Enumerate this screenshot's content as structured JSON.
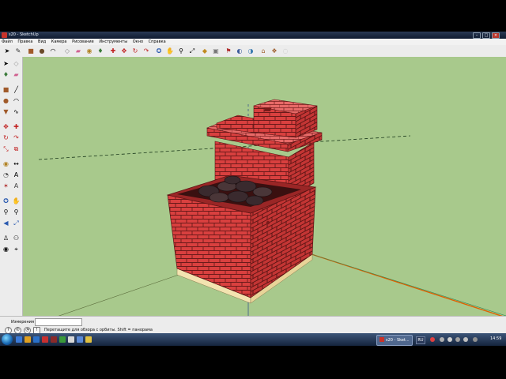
{
  "window": {
    "title": "s20 - SketchUp",
    "controls": [
      "–",
      "□",
      "×"
    ]
  },
  "menu": [
    "Файл",
    "Правка",
    "Вид",
    "Камера",
    "Рисование",
    "Инструменты",
    "Окно",
    "Справка"
  ],
  "toolbar_icons": [
    "select-arrow-icon",
    "pencil-icon",
    "box-icon",
    "circle-icon",
    "arc-icon",
    "shape-icon",
    "eraser-icon",
    "tape-measure-icon",
    "paint-bucket-icon",
    "push-pull-icon",
    "move-icon",
    "rotate-icon",
    "follow-me-icon",
    "orbit-icon",
    "pan-icon",
    "zoom-icon",
    "zoom-extents-icon",
    "components-icon",
    "section-icon",
    "axes-icon",
    "walk-icon",
    "look-around-icon",
    "warehouse-icon",
    "share-icon"
  ],
  "left_tool_icons": [
    "select-icon",
    "make-component-icon",
    "paint-bucket-icon",
    "eraser-icon",
    "rectangle-icon",
    "line-icon",
    "circle-icon",
    "arc-icon",
    "polygon-icon",
    "freehand-icon",
    "move-icon",
    "push-pull-icon",
    "rotate-icon",
    "follow-me-icon",
    "scale-icon",
    "offset-icon",
    "tape-measure-icon",
    "dimension-icon",
    "protractor-icon",
    "text-icon",
    "axes-icon",
    "3d-text-icon",
    "orbit-icon",
    "pan-icon",
    "zoom-icon",
    "zoom-window-icon",
    "previous-view-icon",
    "zoom-extents-icon",
    "position-camera-icon",
    "walk-icon",
    "look-around-icon",
    "section-plane-icon"
  ],
  "status": {
    "measure_label": "Измерения",
    "measure_value": "",
    "hint": "Перетащите для обзора с орбиты. Shift = панорама"
  },
  "taskbar": {
    "task_label": "s20 - Sket...",
    "language": "RU",
    "clock": "14:59"
  },
  "colors": {
    "sky": "#a8c98c",
    "brick": "#d9403f",
    "mortar": "#6b1a1a",
    "foundation": "#f3e3b0",
    "axis_green": "#2e8b57",
    "axis_red": "#e06000"
  }
}
